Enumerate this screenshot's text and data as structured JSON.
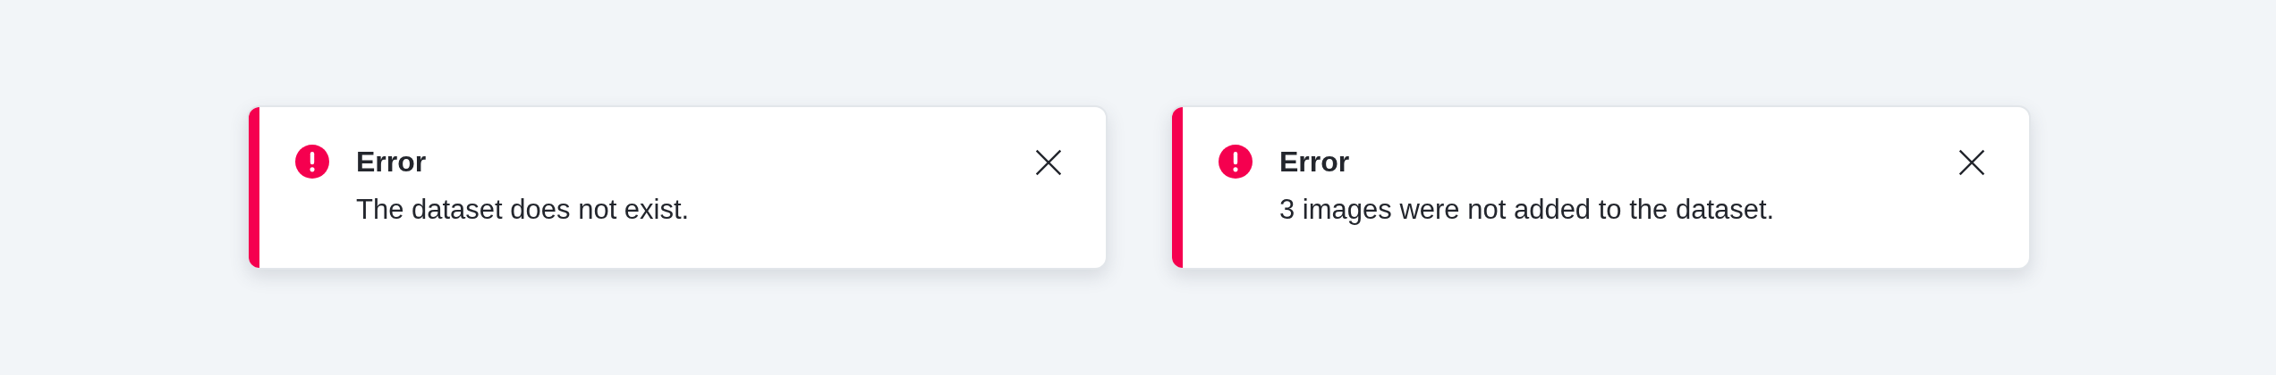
{
  "toasts": [
    {
      "kind": "error",
      "title": "Error",
      "message": "The dataset does not exist."
    },
    {
      "kind": "error",
      "title": "Error",
      "message": "3 images were not added to the dataset."
    }
  ]
}
